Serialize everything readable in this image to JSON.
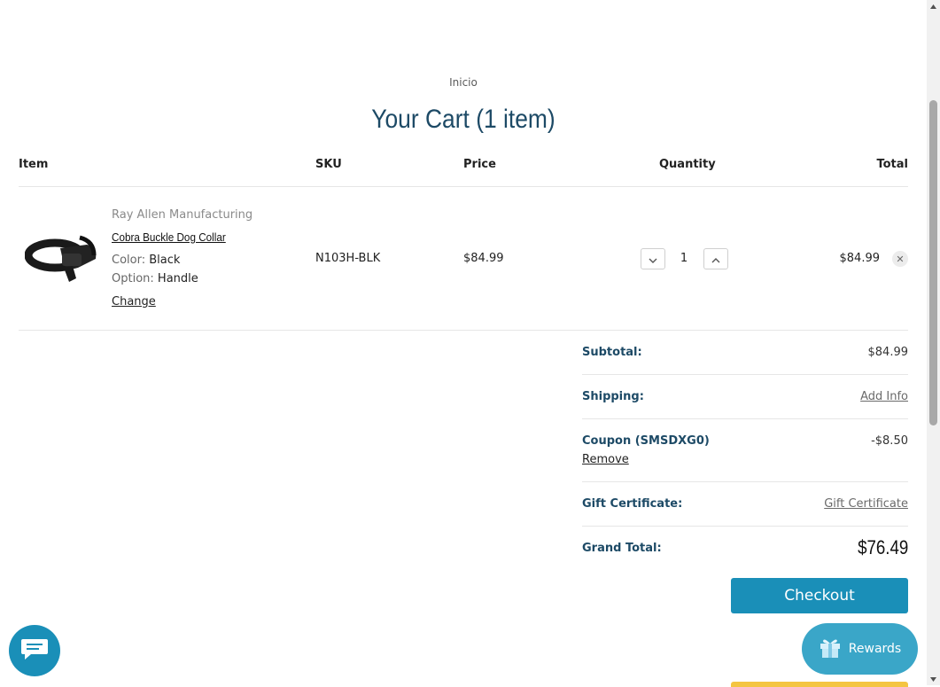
{
  "breadcrumb": "Inicio",
  "title": "Your Cart (1 item)",
  "table": {
    "headers": {
      "item": "Item",
      "sku": "SKU",
      "price": "Price",
      "quantity": "Quantity",
      "total": "Total"
    }
  },
  "item": {
    "brand": "Ray Allen Manufacturing",
    "name": "Cobra Buckle Dog Collar",
    "options": [
      {
        "label": "Color:",
        "value": "Black"
      },
      {
        "label": "Option:",
        "value": "Handle"
      }
    ],
    "change_label": "Change",
    "sku": "N103H-BLK",
    "price": "$84.99",
    "quantity": "1",
    "total": "$84.99"
  },
  "summary": {
    "subtotal_label": "Subtotal:",
    "subtotal_value": "$84.99",
    "shipping_label": "Shipping:",
    "shipping_value": "Add Info",
    "coupon_label": "Coupon (SMSDXG0)",
    "coupon_value": "-$8.50",
    "coupon_remove": "Remove",
    "gift_label": "Gift Certificate:",
    "gift_value": "Gift Certificate",
    "grand_label": "Grand Total:",
    "grand_value": "$76.49"
  },
  "checkout_label": "Checkout",
  "rewards_label": "Rewards",
  "icons": {
    "decrease": "chevron-down-icon",
    "increase": "chevron-up-icon",
    "remove": "close-icon",
    "chat": "chat-icon",
    "rewards": "gift-icon"
  },
  "colors": {
    "accent": "#1a8fb8",
    "heading": "#1d4a66",
    "rewards": "#3aa6c8"
  }
}
